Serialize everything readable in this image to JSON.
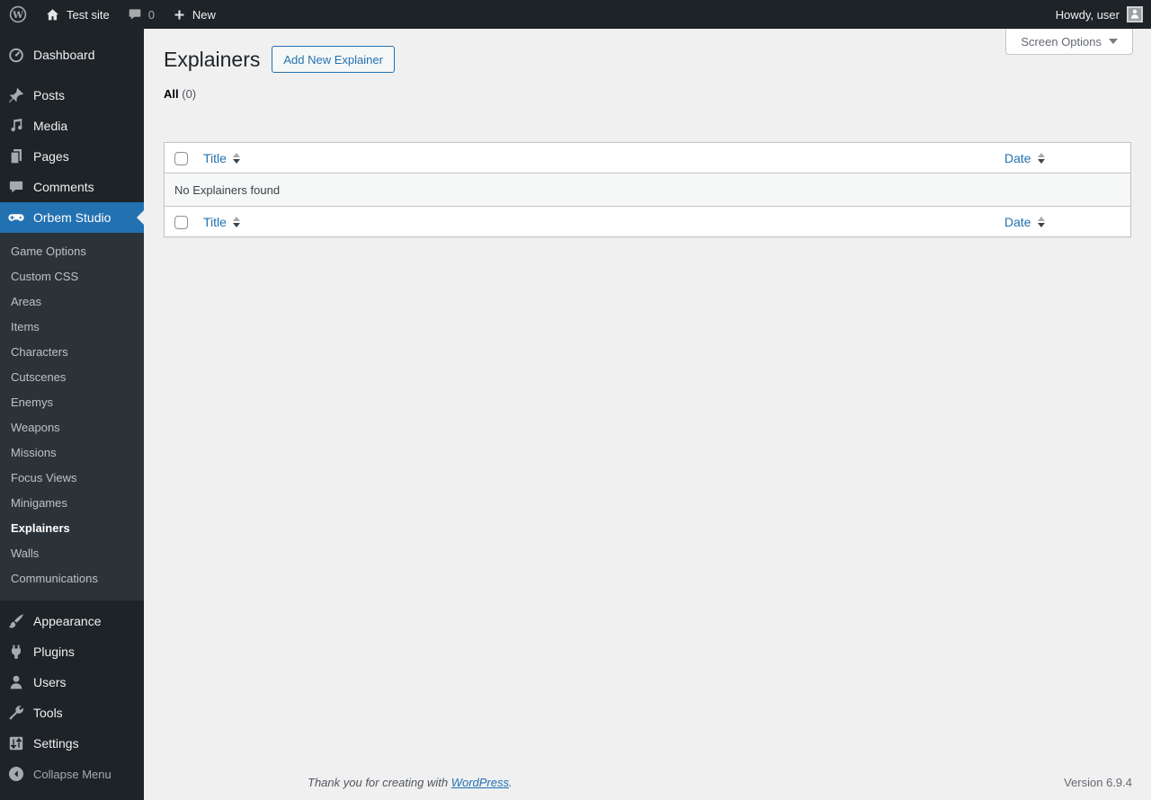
{
  "colors": {
    "accent_blue": "#2271b1",
    "admin_bar_bg": "#1d2327",
    "menu_bg": "#1d2327",
    "submenu_bg": "#2c3338",
    "content_bg": "#f0f0f1",
    "table_border": "#c3c4c7",
    "striped_row_bg": "#f6f7f7",
    "link_blue": "#2271b1"
  },
  "admin_bar": {
    "site_name": "Test site",
    "comment_count": "0",
    "new_label": "New",
    "howdy": "Howdy, user"
  },
  "sidebar": {
    "top_items": [
      {
        "label": "Dashboard",
        "icon": "dashboard-icon"
      },
      {
        "label": "Posts",
        "icon": "pushpin-icon"
      },
      {
        "label": "Media",
        "icon": "media-icon"
      },
      {
        "label": "Pages",
        "icon": "pages-icon"
      },
      {
        "label": "Comments",
        "icon": "comment-icon"
      },
      {
        "label": "Orbem Studio",
        "icon": "gamepad-icon"
      }
    ],
    "active_item": "Orbem Studio",
    "submenu": [
      "Game Options",
      "Custom CSS",
      "Areas",
      "Items",
      "Characters",
      "Cutscenes",
      "Enemys",
      "Weapons",
      "Missions",
      "Focus Views",
      "Minigames",
      "Explainers",
      "Walls",
      "Communications"
    ],
    "active_submenu": "Explainers",
    "bottom_items": [
      {
        "label": "Appearance",
        "icon": "brush-icon"
      },
      {
        "label": "Plugins",
        "icon": "plug-icon"
      },
      {
        "label": "Users",
        "icon": "user-icon"
      },
      {
        "label": "Tools",
        "icon": "wrench-icon"
      },
      {
        "label": "Settings",
        "icon": "settings-icon"
      }
    ],
    "collapse_label": "Collapse Menu"
  },
  "screen_options": {
    "label": "Screen Options"
  },
  "page": {
    "title": "Explainers",
    "add_new_label": "Add New Explainer",
    "filter_all_label": "All",
    "filter_all_count": "(0)"
  },
  "table": {
    "columns": [
      "Title",
      "Date"
    ],
    "empty_message": "No Explainers found"
  },
  "footer": {
    "thanks_text": "Thank you for creating with",
    "wordpress_link": "WordPress",
    "period": ".",
    "version": "Version 6.9.4"
  }
}
